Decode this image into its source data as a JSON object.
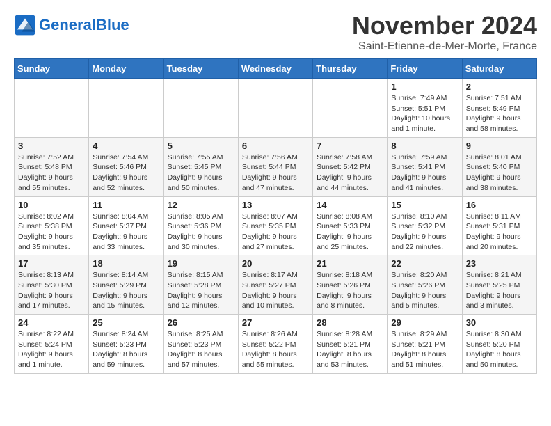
{
  "header": {
    "logo_line1": "General",
    "logo_line2": "Blue",
    "month": "November 2024",
    "location": "Saint-Etienne-de-Mer-Morte, France"
  },
  "weekdays": [
    "Sunday",
    "Monday",
    "Tuesday",
    "Wednesday",
    "Thursday",
    "Friday",
    "Saturday"
  ],
  "weeks": [
    [
      {
        "day": "",
        "info": ""
      },
      {
        "day": "",
        "info": ""
      },
      {
        "day": "",
        "info": ""
      },
      {
        "day": "",
        "info": ""
      },
      {
        "day": "",
        "info": ""
      },
      {
        "day": "1",
        "info": "Sunrise: 7:49 AM\nSunset: 5:51 PM\nDaylight: 10 hours and 1 minute."
      },
      {
        "day": "2",
        "info": "Sunrise: 7:51 AM\nSunset: 5:49 PM\nDaylight: 9 hours and 58 minutes."
      }
    ],
    [
      {
        "day": "3",
        "info": "Sunrise: 7:52 AM\nSunset: 5:48 PM\nDaylight: 9 hours and 55 minutes."
      },
      {
        "day": "4",
        "info": "Sunrise: 7:54 AM\nSunset: 5:46 PM\nDaylight: 9 hours and 52 minutes."
      },
      {
        "day": "5",
        "info": "Sunrise: 7:55 AM\nSunset: 5:45 PM\nDaylight: 9 hours and 50 minutes."
      },
      {
        "day": "6",
        "info": "Sunrise: 7:56 AM\nSunset: 5:44 PM\nDaylight: 9 hours and 47 minutes."
      },
      {
        "day": "7",
        "info": "Sunrise: 7:58 AM\nSunset: 5:42 PM\nDaylight: 9 hours and 44 minutes."
      },
      {
        "day": "8",
        "info": "Sunrise: 7:59 AM\nSunset: 5:41 PM\nDaylight: 9 hours and 41 minutes."
      },
      {
        "day": "9",
        "info": "Sunrise: 8:01 AM\nSunset: 5:40 PM\nDaylight: 9 hours and 38 minutes."
      }
    ],
    [
      {
        "day": "10",
        "info": "Sunrise: 8:02 AM\nSunset: 5:38 PM\nDaylight: 9 hours and 35 minutes."
      },
      {
        "day": "11",
        "info": "Sunrise: 8:04 AM\nSunset: 5:37 PM\nDaylight: 9 hours and 33 minutes."
      },
      {
        "day": "12",
        "info": "Sunrise: 8:05 AM\nSunset: 5:36 PM\nDaylight: 9 hours and 30 minutes."
      },
      {
        "day": "13",
        "info": "Sunrise: 8:07 AM\nSunset: 5:35 PM\nDaylight: 9 hours and 27 minutes."
      },
      {
        "day": "14",
        "info": "Sunrise: 8:08 AM\nSunset: 5:33 PM\nDaylight: 9 hours and 25 minutes."
      },
      {
        "day": "15",
        "info": "Sunrise: 8:10 AM\nSunset: 5:32 PM\nDaylight: 9 hours and 22 minutes."
      },
      {
        "day": "16",
        "info": "Sunrise: 8:11 AM\nSunset: 5:31 PM\nDaylight: 9 hours and 20 minutes."
      }
    ],
    [
      {
        "day": "17",
        "info": "Sunrise: 8:13 AM\nSunset: 5:30 PM\nDaylight: 9 hours and 17 minutes."
      },
      {
        "day": "18",
        "info": "Sunrise: 8:14 AM\nSunset: 5:29 PM\nDaylight: 9 hours and 15 minutes."
      },
      {
        "day": "19",
        "info": "Sunrise: 8:15 AM\nSunset: 5:28 PM\nDaylight: 9 hours and 12 minutes."
      },
      {
        "day": "20",
        "info": "Sunrise: 8:17 AM\nSunset: 5:27 PM\nDaylight: 9 hours and 10 minutes."
      },
      {
        "day": "21",
        "info": "Sunrise: 8:18 AM\nSunset: 5:26 PM\nDaylight: 9 hours and 8 minutes."
      },
      {
        "day": "22",
        "info": "Sunrise: 8:20 AM\nSunset: 5:26 PM\nDaylight: 9 hours and 5 minutes."
      },
      {
        "day": "23",
        "info": "Sunrise: 8:21 AM\nSunset: 5:25 PM\nDaylight: 9 hours and 3 minutes."
      }
    ],
    [
      {
        "day": "24",
        "info": "Sunrise: 8:22 AM\nSunset: 5:24 PM\nDaylight: 9 hours and 1 minute."
      },
      {
        "day": "25",
        "info": "Sunrise: 8:24 AM\nSunset: 5:23 PM\nDaylight: 8 hours and 59 minutes."
      },
      {
        "day": "26",
        "info": "Sunrise: 8:25 AM\nSunset: 5:23 PM\nDaylight: 8 hours and 57 minutes."
      },
      {
        "day": "27",
        "info": "Sunrise: 8:26 AM\nSunset: 5:22 PM\nDaylight: 8 hours and 55 minutes."
      },
      {
        "day": "28",
        "info": "Sunrise: 8:28 AM\nSunset: 5:21 PM\nDaylight: 8 hours and 53 minutes."
      },
      {
        "day": "29",
        "info": "Sunrise: 8:29 AM\nSunset: 5:21 PM\nDaylight: 8 hours and 51 minutes."
      },
      {
        "day": "30",
        "info": "Sunrise: 8:30 AM\nSunset: 5:20 PM\nDaylight: 8 hours and 50 minutes."
      }
    ]
  ]
}
